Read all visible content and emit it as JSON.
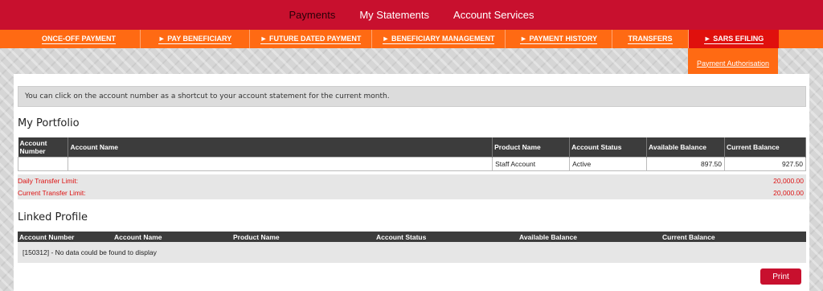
{
  "top_nav": {
    "items": [
      "Payments",
      "My Statements",
      "Account Services"
    ],
    "active": "Payments",
    "color": "#c8102e"
  },
  "sub_nav": {
    "items": [
      "ONCE-OFF PAYMENT",
      "► PAY BENEFICIARY",
      "► FUTURE DATED PAYMENT",
      "► BENEFICIARY MANAGEMENT",
      "► PAYMENT HISTORY",
      "TRANSFERS",
      "► SARS EFILING"
    ],
    "color": "#ff6a13",
    "dropdown_item": "Payment Authorisation"
  },
  "info_text": "You can click on the account number as a shortcut to your account statement for the current month.",
  "portfolio": {
    "title": "My Portfolio",
    "columns": [
      "Account Number",
      "Account Name",
      "Product Name",
      "Account Status",
      "Available Balance",
      "Current Balance"
    ],
    "rows": [
      {
        "account_number": "",
        "account_name": "",
        "product_name": "Staff Account",
        "account_status": "Active",
        "available_balance": "897.50",
        "current_balance": "927.50"
      }
    ],
    "daily_limit_label": "Daily Transfer Limit:",
    "daily_limit_value": "20,000.00",
    "current_limit_label": "Current Transfer Limit:",
    "current_limit_value": "20,000.00"
  },
  "linked": {
    "title": "Linked Profile",
    "columns": [
      "Account Number",
      "Account Name",
      "Product Name",
      "Account Status",
      "Available Balance",
      "Current Balance"
    ],
    "no_data": "[150312] - No data could be found to display"
  },
  "print_label": "Print"
}
